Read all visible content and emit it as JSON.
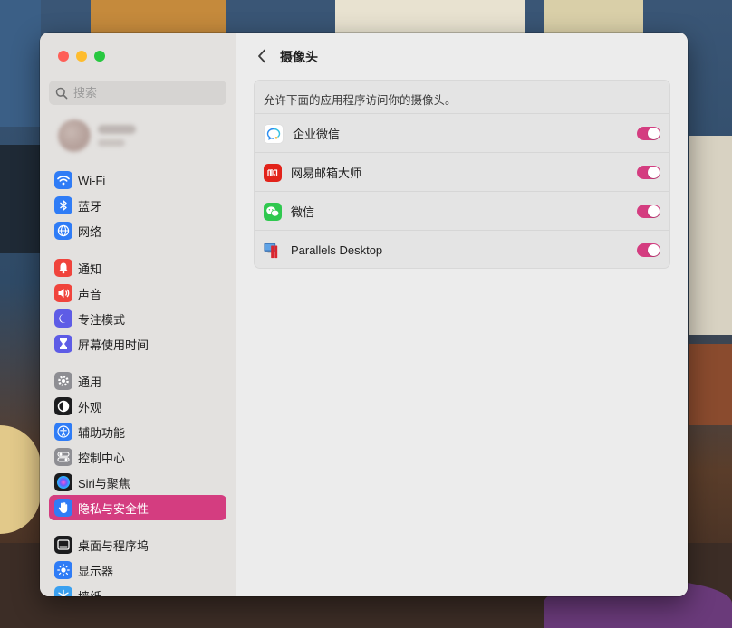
{
  "window": {
    "search": {
      "placeholder": "搜索"
    },
    "sidebar": {
      "groups": [
        [
          {
            "label": "Wi-Fi",
            "icon": "wifi-icon",
            "color": "#2f7cf6"
          },
          {
            "label": "蓝牙",
            "icon": "bluetooth-icon",
            "color": "#2f7cf6"
          },
          {
            "label": "网络",
            "icon": "globe-icon",
            "color": "#2f7cf6"
          }
        ],
        [
          {
            "label": "通知",
            "icon": "bell-icon",
            "color": "#f0443c"
          },
          {
            "label": "声音",
            "icon": "speaker-icon",
            "color": "#f0443c"
          },
          {
            "label": "专注模式",
            "icon": "moon-icon",
            "color": "#5e5ce6"
          },
          {
            "label": "屏幕使用时间",
            "icon": "hourglass-icon",
            "color": "#5e5ce6"
          }
        ],
        [
          {
            "label": "通用",
            "icon": "gear-icon",
            "color": "#8e8e93"
          },
          {
            "label": "外观",
            "icon": "appearance-icon",
            "color": "#1c1c1e"
          },
          {
            "label": "辅助功能",
            "icon": "accessibility-icon",
            "color": "#2f7cf6"
          },
          {
            "label": "控制中心",
            "icon": "control-center-icon",
            "color": "#8e8e93"
          },
          {
            "label": "Siri与聚焦",
            "icon": "siri-icon",
            "color": "#1c1c1e"
          },
          {
            "label": "隐私与安全性",
            "icon": "hand-icon",
            "color": "#2f7cf6",
            "active": true
          }
        ],
        [
          {
            "label": "桌面与程序坞",
            "icon": "dock-icon",
            "color": "#1c1c1e"
          },
          {
            "label": "显示器",
            "icon": "display-icon",
            "color": "#2f7cf6"
          },
          {
            "label": "墙纸",
            "icon": "wallpaper-icon",
            "color": "#3aa0f0"
          }
        ]
      ]
    },
    "main": {
      "title": "摄像头",
      "description": "允许下面的应用程序访问你的摄像头。",
      "apps": [
        {
          "name": "企业微信",
          "icon": "wecom-icon",
          "enabled": true
        },
        {
          "name": "网易邮箱大师",
          "icon": "netease-mail-icon",
          "enabled": true
        },
        {
          "name": "微信",
          "icon": "wechat-icon",
          "enabled": true
        },
        {
          "name": "Parallels Desktop",
          "icon": "parallels-icon",
          "enabled": true
        }
      ]
    },
    "accent_color": "#d43d80"
  }
}
